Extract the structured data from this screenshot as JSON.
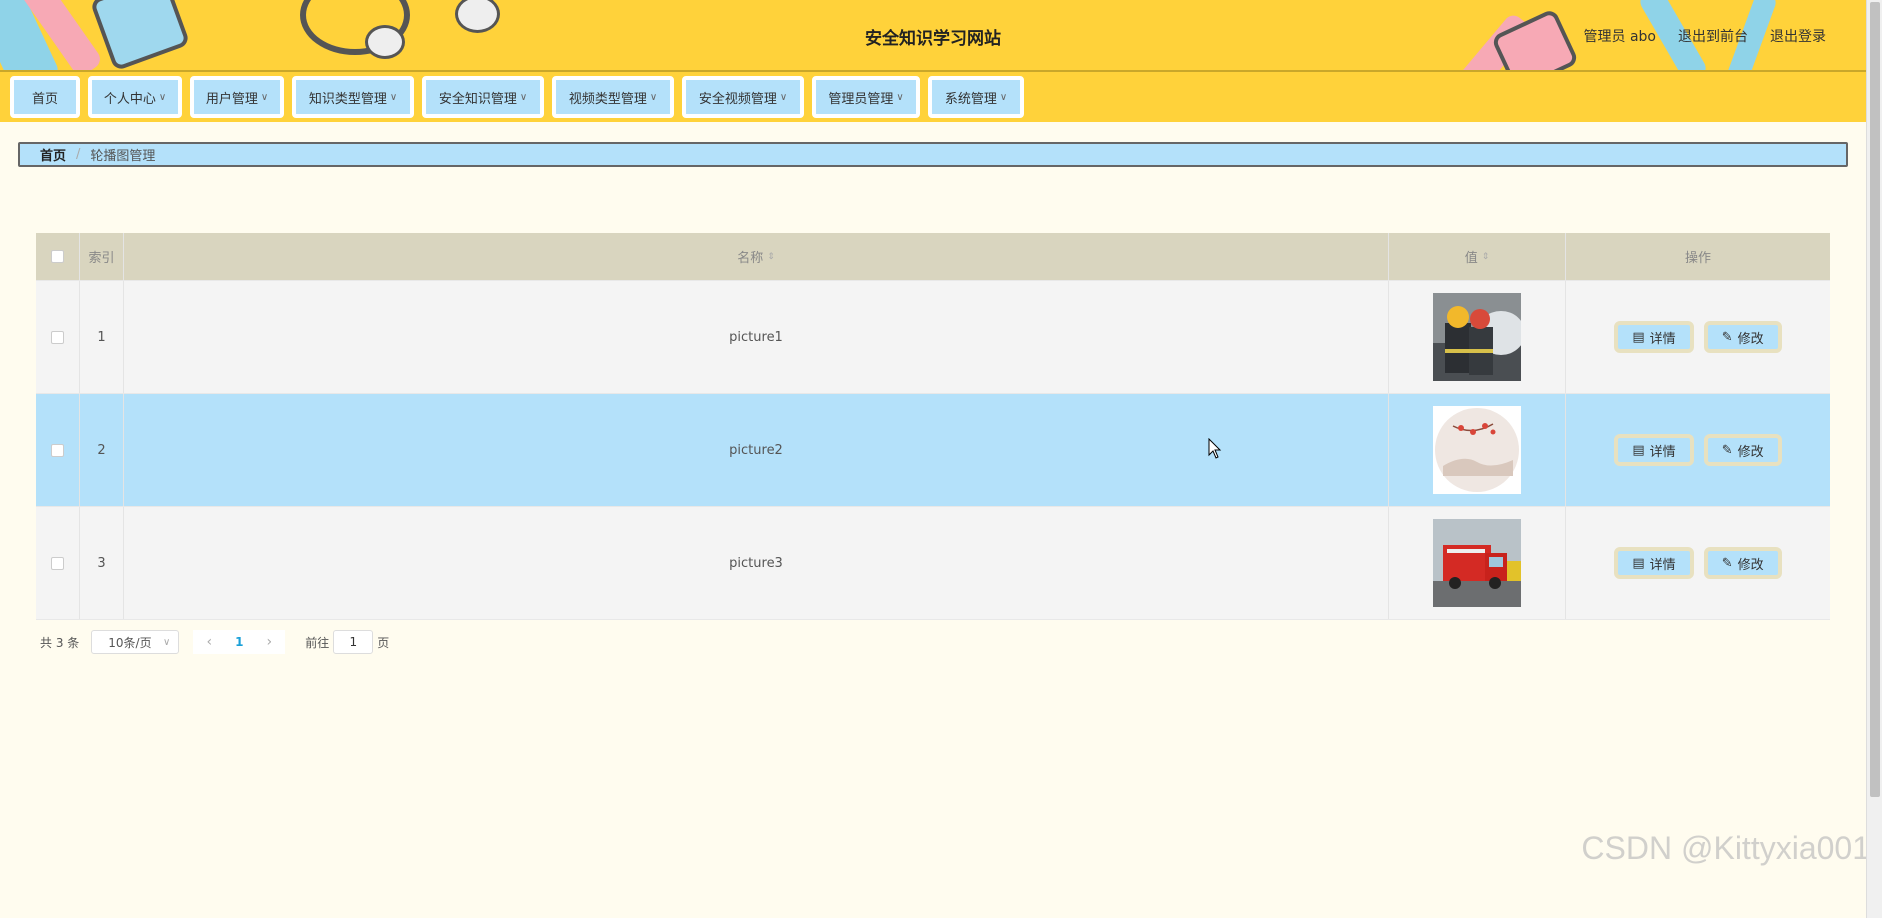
{
  "header": {
    "title": "安全知识学习网站",
    "user": "管理员 abo",
    "to_front": "退出到前台",
    "logout": "退出登录"
  },
  "nav": {
    "items": [
      "首页",
      "个人中心",
      "用户管理",
      "知识类型管理",
      "安全知识管理",
      "视频类型管理",
      "安全视频管理",
      "管理员管理",
      "系统管理"
    ]
  },
  "breadcrumb": {
    "home": "首页",
    "current": "轮播图管理"
  },
  "table": {
    "headers": {
      "index": "索引",
      "name": "名称",
      "value": "值",
      "ops": "操作"
    },
    "rows": [
      {
        "index": "1",
        "name": "picture1",
        "thumb": "firefighters-photo",
        "detail": "详情",
        "edit": "修改"
      },
      {
        "index": "2",
        "name": "picture2",
        "thumb": "landscape-circle-painting",
        "detail": "详情",
        "edit": "修改"
      },
      {
        "index": "3",
        "name": "picture3",
        "thumb": "fire-truck-photo",
        "detail": "详情",
        "edit": "修改"
      }
    ],
    "highlighted_row": 2
  },
  "pagination": {
    "total": "共 3 条",
    "page_size": "10条/页",
    "current_page": "1",
    "goto_label": "前往",
    "goto_value": "1",
    "page_unit": "页"
  },
  "watermark": "CSDN @Kittyxia001",
  "colors": {
    "header_bg": "#ffd23a",
    "accent": "#b4e1fa",
    "page_bg": "#fffcef"
  }
}
